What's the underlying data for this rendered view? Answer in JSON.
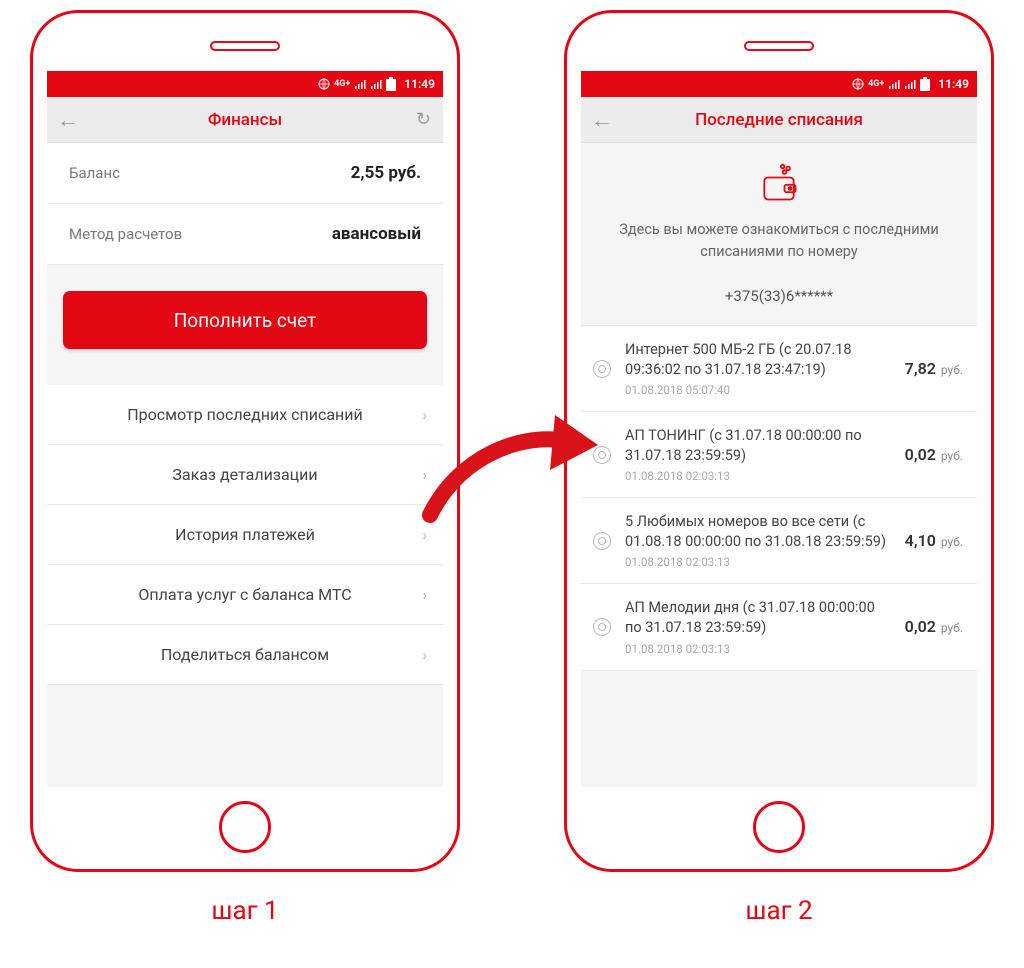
{
  "colors": {
    "accent": "#e30613"
  },
  "statusbar": {
    "time": "11:49",
    "net_label": "4G+"
  },
  "step_labels": {
    "step1": "шаг 1",
    "step2": "шаг 2"
  },
  "screen1": {
    "title": "Финансы",
    "balance_label": "Баланс",
    "balance_value": "2,55 руб.",
    "method_label": "Метод расчетов",
    "method_value": "авансовый",
    "topup_btn": "Пополнить счет",
    "menu": [
      "Просмотр последних списаний",
      "Заказ детализации",
      "История платежей",
      "Оплата услуг с баланса МТС",
      "Поделиться балансом"
    ]
  },
  "screen2": {
    "title": "Последние списания",
    "intro_line": "Здесь вы можете ознакомиться с последними списаниями по номеру",
    "phone": "+375(33)6******",
    "currency": "руб.",
    "txns": [
      {
        "desc": "Интернет 500 МБ-2 ГБ (с 20.07.18 09:36:02 по 31.07.18 23:47:19)",
        "ts": "01.08.2018 05:07:40",
        "amount": "7,82"
      },
      {
        "desc": "АП ТОНИНГ (с 31.07.18 00:00:00 по 31.07.18 23:59:59)",
        "ts": "01.08.2018 02:03:13",
        "amount": "0,02"
      },
      {
        "desc": "5 Любимых номеров во все сети (с 01.08.18 00:00:00 по 31.08.18 23:59:59)",
        "ts": "01.08.2018 02:03:13",
        "amount": "4,10"
      },
      {
        "desc": "АП Мелодии дня (с 31.07.18 00:00:00 по 31.07.18 23:59:59)",
        "ts": "01.08.2018 02:03:13",
        "amount": "0,02"
      }
    ]
  }
}
